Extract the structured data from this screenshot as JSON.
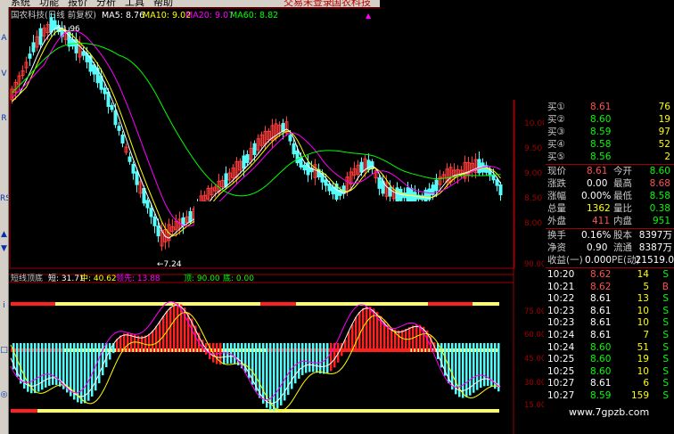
{
  "menu": {
    "items": [
      "系统",
      "功能",
      "报价",
      "分析",
      "工具",
      "帮助"
    ],
    "login": "交易未登录",
    "stock_name": "国农科技"
  },
  "toolbar_glyphs": [
    "A",
    "V",
    "R",
    "RSI",
    "▲",
    "▼",
    "i",
    "□",
    "◎"
  ],
  "main_chart": {
    "title": "国农科技(日线 前复权)",
    "ma5_label": "MA5: 8.76",
    "ma10_label": "MA10: 9.02",
    "ma20_label": "MA20: 9.07",
    "ma60_label": "MA60: 8.82",
    "high_label": "11.96",
    "low_label": "7.24",
    "y_ticks": [
      "10.00",
      "9.50",
      "9.00",
      "8.50",
      "8.00"
    ],
    "colors": {
      "up": "#ff3c3c",
      "down": "#54fcfc",
      "ma5": "#ffffff",
      "ma10": "#ffff00",
      "ma20": "#ff00ff",
      "ma60": "#00ff00"
    }
  },
  "indicator": {
    "title": "短线顶底",
    "short_label": "短: 31.71",
    "mid_label": "中: 40.62",
    "lead_label": "领先: 13.88",
    "top_label": "顶: 90.00",
    "bottom_label": "底: 0.00",
    "y_ticks": [
      "90.00",
      "75.00",
      "60.00",
      "45.00",
      "30.00",
      "15.00"
    ]
  },
  "quote": {
    "bids": [
      {
        "label": "买①",
        "price": "8.61",
        "vol": "76"
      },
      {
        "label": "买②",
        "price": "8.60",
        "vol": "19"
      },
      {
        "label": "买③",
        "price": "8.59",
        "vol": "97"
      },
      {
        "label": "买④",
        "price": "8.58",
        "vol": "52"
      },
      {
        "label": "买⑤",
        "price": "8.56",
        "vol": "2"
      }
    ],
    "stats": [
      {
        "l1": "现价",
        "v1": "8.61",
        "l2": "今开",
        "v2": "8.60",
        "c1": "#ff5050",
        "c2": "#00ff00"
      },
      {
        "l1": "涨跌",
        "v1": "0.00",
        "l2": "最高",
        "v2": "8.68",
        "c1": "#ffffff",
        "c2": "#ff5050"
      },
      {
        "l1": "涨幅",
        "v1": "0.00%",
        "l2": "最低",
        "v2": "8.58",
        "c1": "#ffffff",
        "c2": "#00ff00"
      },
      {
        "l1": "总量",
        "v1": "1362",
        "l2": "量比",
        "v2": "0.38",
        "c1": "#ffff00",
        "c2": "#00ff00"
      },
      {
        "l1": "外盘",
        "v1": "411",
        "l2": "内盘",
        "v2": "951",
        "c1": "#ff5050",
        "c2": "#00ff00"
      }
    ],
    "info": [
      {
        "l1": "换手",
        "v1": "0.16%",
        "l2": "股本",
        "v2": "8397万"
      },
      {
        "l1": "净资",
        "v1": "0.90",
        "l2": "流通",
        "v2": "8387万"
      },
      {
        "l1": "收益(一)",
        "v1": "0.000",
        "l2": "PE(动)",
        "v2": "21519.0"
      }
    ],
    "ticks": [
      {
        "time": "10:20",
        "price": "8.62",
        "vol": "14",
        "bs": "S",
        "pc": "#ff5050",
        "vc": "#00ff00"
      },
      {
        "time": "10:21",
        "price": "8.62",
        "vol": "5",
        "bs": "B",
        "pc": "#ff5050",
        "vc": "#ff5050"
      },
      {
        "time": "10:22",
        "price": "8.61",
        "vol": "13",
        "bs": "S",
        "pc": "#ffffff",
        "vc": "#00ff00"
      },
      {
        "time": "10:23",
        "price": "8.61",
        "vol": "10",
        "bs": "S",
        "pc": "#ffffff",
        "vc": "#00ff00"
      },
      {
        "time": "10:23",
        "price": "8.61",
        "vol": "10",
        "bs": "S",
        "pc": "#ffffff",
        "vc": "#00ff00"
      },
      {
        "time": "10:24",
        "price": "8.61",
        "vol": "7",
        "bs": "S",
        "pc": "#ffffff",
        "vc": "#00ff00"
      },
      {
        "time": "10:24",
        "price": "8.60",
        "vol": "51",
        "bs": "S",
        "pc": "#00ff00",
        "vc": "#00ff00"
      },
      {
        "time": "10:25",
        "price": "8.60",
        "vol": "19",
        "bs": "S",
        "pc": "#00ff00",
        "vc": "#00ff00"
      },
      {
        "time": "10:25",
        "price": "8.60",
        "vol": "10",
        "bs": "S",
        "pc": "#00ff00",
        "vc": "#00ff00"
      },
      {
        "time": "10:27",
        "price": "8.61",
        "vol": "6",
        "bs": "S",
        "pc": "#ffffff",
        "vc": "#00ff00"
      },
      {
        "time": "10:27",
        "price": "8.59",
        "vol": "159",
        "bs": "S",
        "pc": "#00ff00",
        "vc": "#00ff00"
      }
    ]
  },
  "watermark": "www.7gpzb.com"
}
